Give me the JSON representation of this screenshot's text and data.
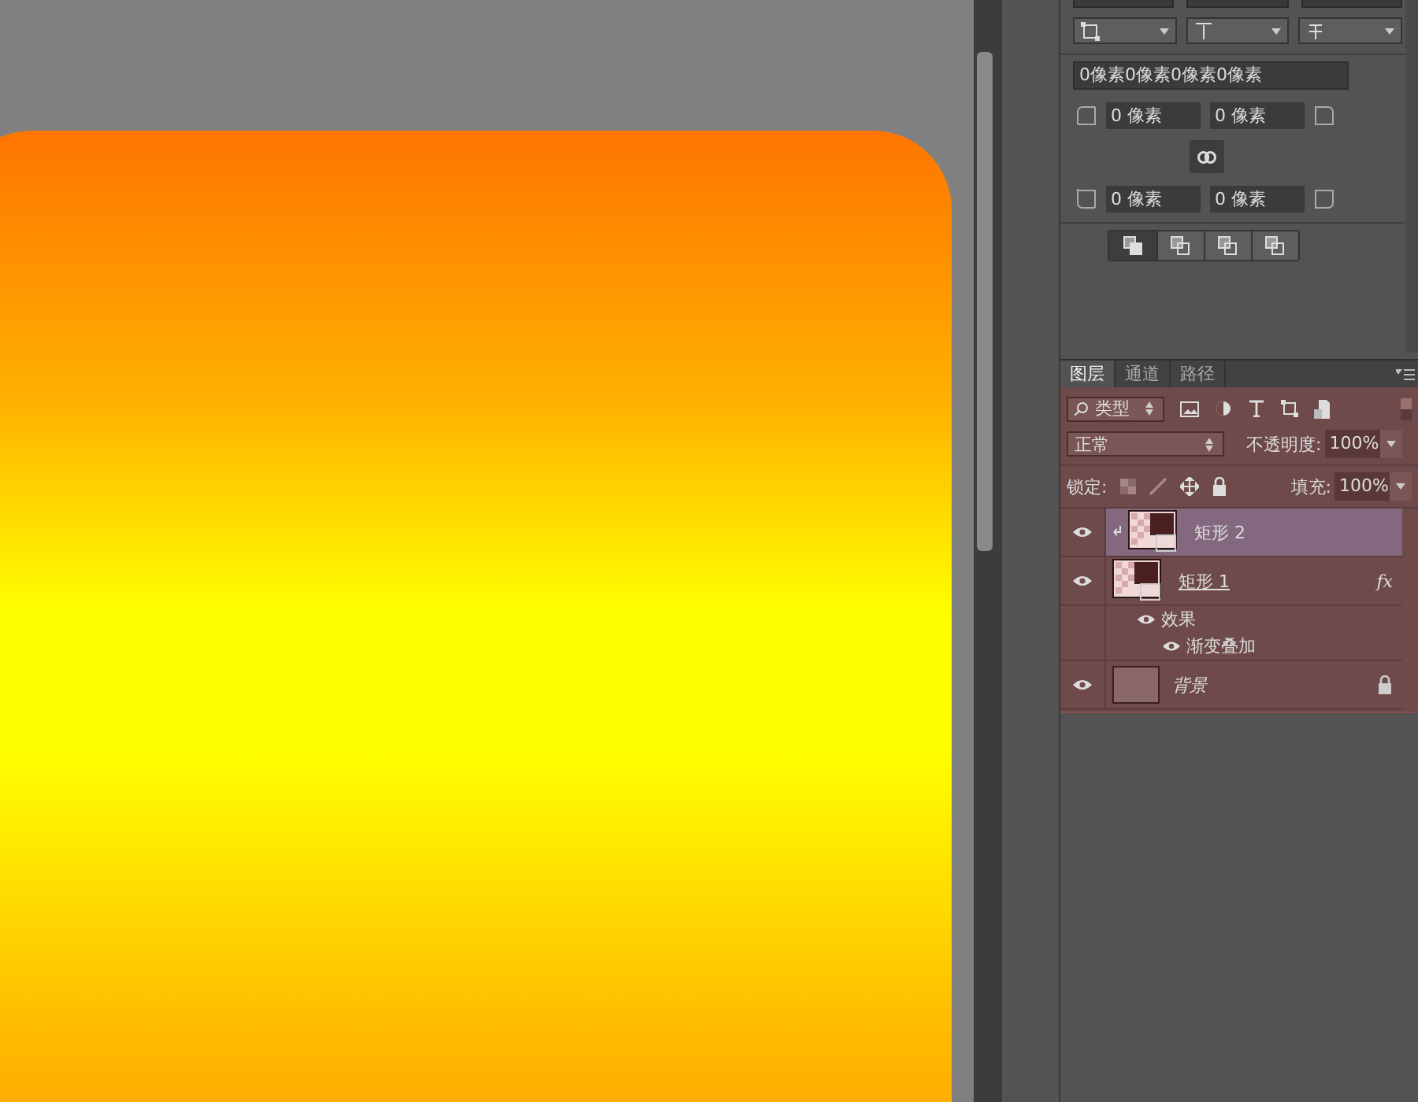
{
  "properties": {
    "margins_field": {
      "value": "0像素0像素0像素0像素"
    },
    "corner_rows": [
      {
        "left": "0 像素",
        "right": "0 像素"
      },
      {
        "left": "0 像素",
        "right": "0 像素"
      }
    ]
  },
  "layers_panel": {
    "tabs": [
      {
        "label": "图层",
        "selected": true
      },
      {
        "label": "通道",
        "selected": false
      },
      {
        "label": "路径",
        "selected": false
      }
    ],
    "filter": {
      "value": "类型"
    },
    "blend_mode": {
      "value": "正常"
    },
    "opacity": {
      "label": "不透明度:",
      "value": "100%"
    },
    "lock": {
      "label": "锁定:"
    },
    "fill": {
      "label": "填充:",
      "value": "100%"
    },
    "layers": [
      {
        "name": "矩形 2",
        "kind": "shape",
        "selected": true,
        "visible": true,
        "clipped": true,
        "locked": false
      },
      {
        "name": "矩形 1",
        "kind": "shape",
        "selected": false,
        "visible": true,
        "clipped": false,
        "locked": false,
        "fx": "fx",
        "effects": {
          "label": "效果",
          "visible": true,
          "children": [
            {
              "label": "渐变叠加",
              "visible": true
            }
          ]
        }
      },
      {
        "name": "背景",
        "kind": "background",
        "selected": false,
        "visible": true,
        "clipped": false,
        "locked": true
      }
    ]
  }
}
